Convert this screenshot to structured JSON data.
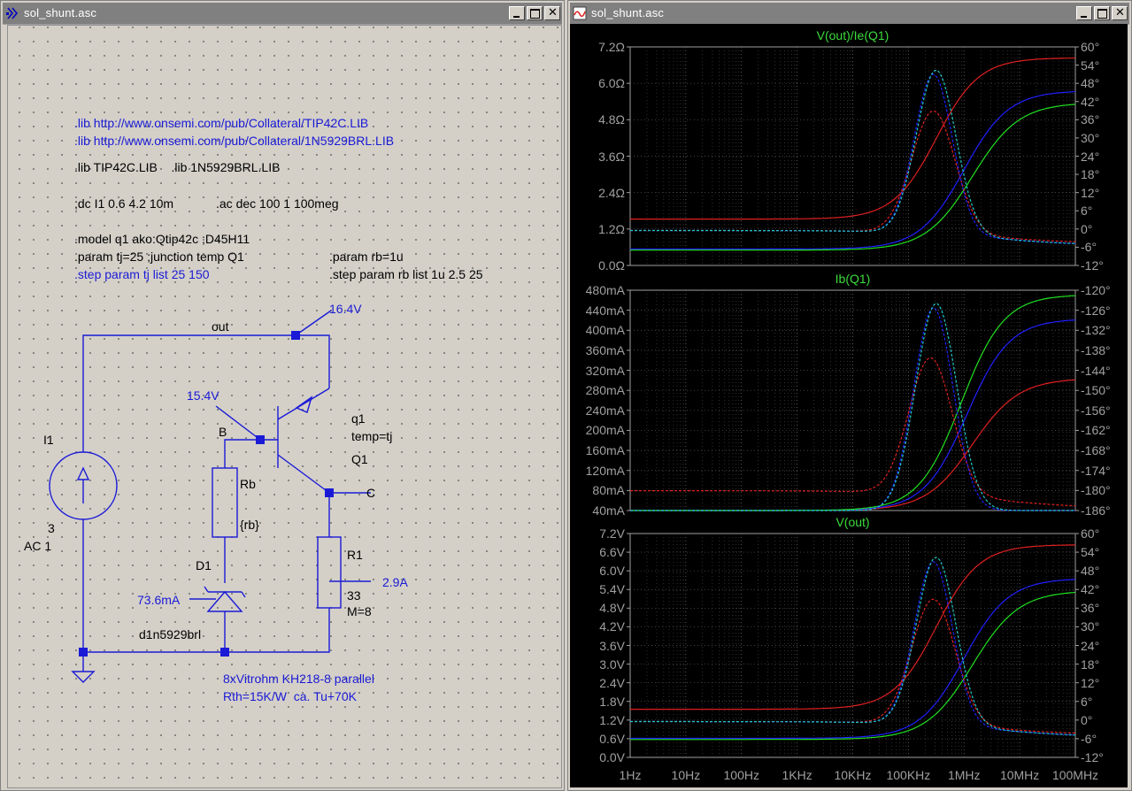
{
  "left_window": {
    "title": "sol_shunt.asc"
  },
  "right_window": {
    "title": "sol_shunt.asc"
  },
  "schematic": {
    "directives": {
      "lib_url1": ".lib http://www.onsemi.com/pub/Collateral/TIP42C.LIB",
      "lib_url2": ".lib http://www.onsemi.com/pub/Collateral/1N5929BRL.LIB",
      "lib_local": ".lib TIP42C.LIB    .lib 1N5929BRL.LIB",
      "dc": ";dc I1 0.6 4.2 10m",
      "ac": ".ac dec 100 1 100meg",
      "model": ".model q1 ako:Qtip42c ;D45H11",
      "param_tj": ".param tj=25 ;junction temp Q1",
      "param_rb": ".param rb=1u",
      "step_tj": ".step param tj list 25 150",
      "step_rb": ".step param rb list 1u 2.5 25"
    },
    "labels": {
      "net_out": "out",
      "v_out": "16.4V",
      "v_base": "15.4V",
      "node_b": "B",
      "q_model": "q1",
      "q_temp": "temp=tj",
      "q_name": "Q1",
      "node_c": "C",
      "i1_name": "I1",
      "i1_value": "3",
      "i1_ac": "AC 1",
      "rb_name": "Rb",
      "rb_value": "{rb}",
      "d1_name": "D1",
      "d1_current": "73.6mA",
      "d1_model": "d1n5929brl",
      "r1_name": "R1",
      "r1_current": "2.9A",
      "r1_value": "33",
      "r1_mult": "M=8",
      "note1": "8xVitrohm KH218-8 parallel",
      "note2": "Rth=15K/W  ca. Tu+70K"
    }
  },
  "plots": {
    "x_ticks": [
      "1Hz",
      "10Hz",
      "100Hz",
      "1KHz",
      "10KHz",
      "100KHz",
      "1MHz",
      "10MHz",
      "100MHz"
    ],
    "panes": [
      {
        "title": "V(out)/Ie(Q1)",
        "left_ticks": [
          "7.2Ω",
          "6.0Ω",
          "4.8Ω",
          "3.6Ω",
          "2.4Ω",
          "1.2Ω",
          "0.0Ω"
        ],
        "right_ticks": [
          "60°",
          "54°",
          "48°",
          "42°",
          "36°",
          "30°",
          "24°",
          "18°",
          "12°",
          "6°",
          "0°",
          "-6°",
          "-12°"
        ]
      },
      {
        "title": "Ib(Q1)",
        "left_ticks": [
          "480mA",
          "440mA",
          "400mA",
          "360mA",
          "320mA",
          "280mA",
          "240mA",
          "200mA",
          "160mA",
          "120mA",
          "80mA",
          "40mA"
        ],
        "right_ticks": [
          "-120°",
          "-126°",
          "-132°",
          "-138°",
          "-144°",
          "-150°",
          "-156°",
          "-162°",
          "-168°",
          "-174°",
          "-180°",
          "-186°"
        ]
      },
      {
        "title": "V(out)",
        "left_ticks": [
          "7.2V",
          "6.6V",
          "6.0V",
          "5.4V",
          "4.8V",
          "4.2V",
          "3.6V",
          "3.0V",
          "2.4V",
          "1.8V",
          "1.2V",
          "0.6V",
          "0.0V"
        ],
        "right_ticks": [
          "60°",
          "54°",
          "48°",
          "42°",
          "36°",
          "30°",
          "24°",
          "18°",
          "12°",
          "6°",
          "0°",
          "-6°",
          "-12°"
        ]
      }
    ],
    "colors": {
      "red": "#e02020",
      "blue": "#2020ff",
      "green": "#20e020",
      "cyan": "#20c8c8",
      "title": "#3cdc3c",
      "axis": "#a0a0a0"
    }
  }
}
